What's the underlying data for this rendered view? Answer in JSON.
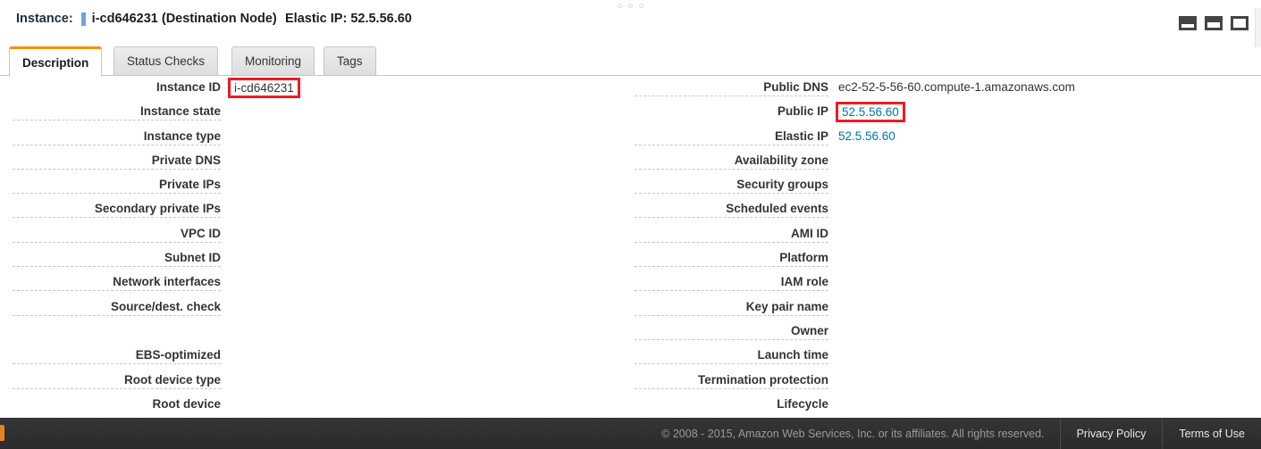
{
  "window": {
    "grip_dots": 3,
    "layout_icons": [
      {
        "name": "panel-size-small",
        "label": "Small panel"
      },
      {
        "name": "panel-size-medium",
        "label": "Medium panel"
      },
      {
        "name": "panel-size-large",
        "label": "Large panel"
      }
    ]
  },
  "header": {
    "instance_label": "Instance:",
    "instance_id": "i-cd646231 (Destination Node)",
    "elastic_ip_label": "Elastic IP:",
    "elastic_ip_value": "52.5.56.60",
    "elastic_ip_full": "Elastic IP: 52.5.56.60"
  },
  "tabs": [
    {
      "label": "Description",
      "active": true
    },
    {
      "label": "Status Checks",
      "active": false
    },
    {
      "label": "Monitoring",
      "active": false
    },
    {
      "label": "Tags",
      "active": false
    }
  ],
  "details": {
    "left": [
      {
        "label": "Instance ID",
        "value": "i-cd646231",
        "highlight": true,
        "dotted": false
      },
      {
        "label": "Instance state",
        "value": "",
        "highlight": false,
        "dotted": true
      },
      {
        "label": "Instance type",
        "value": "",
        "highlight": false,
        "dotted": true
      },
      {
        "label": "Private DNS",
        "value": "",
        "highlight": false,
        "dotted": true
      },
      {
        "label": "Private IPs",
        "value": "",
        "highlight": false,
        "dotted": true
      },
      {
        "label": "Secondary private IPs",
        "value": "",
        "highlight": false,
        "dotted": true
      },
      {
        "label": "VPC ID",
        "value": "",
        "highlight": false,
        "dotted": true
      },
      {
        "label": "Subnet ID",
        "value": "",
        "highlight": false,
        "dotted": true
      },
      {
        "label": "Network interfaces",
        "value": "",
        "highlight": false,
        "dotted": true
      },
      {
        "label": "Source/dest. check",
        "value": "",
        "highlight": false,
        "dotted": true
      },
      {
        "label": "",
        "value": "",
        "highlight": false,
        "dotted": false
      },
      {
        "label": "EBS-optimized",
        "value": "",
        "highlight": false,
        "dotted": true
      },
      {
        "label": "Root device type",
        "value": "",
        "highlight": false,
        "dotted": true
      },
      {
        "label": "Root device",
        "value": "",
        "highlight": false,
        "dotted": false
      }
    ],
    "right": [
      {
        "label": "Public DNS",
        "value": "ec2-52-5-56-60.compute-1.amazonaws.com",
        "link": false,
        "highlight": false,
        "dotted": true
      },
      {
        "label": "Public IP",
        "value": "52.5.56.60",
        "link": true,
        "highlight": true,
        "dotted": false
      },
      {
        "label": "Elastic IP",
        "value": "52.5.56.60",
        "link": true,
        "highlight": false,
        "dotted": true
      },
      {
        "label": "Availability zone",
        "value": "",
        "link": false,
        "highlight": false,
        "dotted": true
      },
      {
        "label": "Security groups",
        "value": "",
        "link": false,
        "highlight": false,
        "dotted": true
      },
      {
        "label": "Scheduled events",
        "value": "",
        "link": false,
        "highlight": false,
        "dotted": true
      },
      {
        "label": "AMI ID",
        "value": "",
        "link": false,
        "highlight": false,
        "dotted": true
      },
      {
        "label": "Platform",
        "value": "",
        "link": false,
        "highlight": false,
        "dotted": true
      },
      {
        "label": "IAM role",
        "value": "",
        "link": false,
        "highlight": false,
        "dotted": true
      },
      {
        "label": "Key pair name",
        "value": "",
        "link": false,
        "highlight": false,
        "dotted": true
      },
      {
        "label": "Owner",
        "value": "",
        "link": false,
        "highlight": false,
        "dotted": true
      },
      {
        "label": "Launch time",
        "value": "",
        "link": false,
        "highlight": false,
        "dotted": true
      },
      {
        "label": "Termination protection",
        "value": "",
        "link": false,
        "highlight": false,
        "dotted": true
      },
      {
        "label": "Lifecycle",
        "value": "",
        "link": false,
        "highlight": false,
        "dotted": false
      }
    ]
  },
  "footer": {
    "copyright": "© 2008 - 2015, Amazon Web Services, Inc. or its affiliates. All rights reserved.",
    "links": [
      {
        "label": "Privacy Policy"
      },
      {
        "label": "Terms of Use"
      }
    ]
  },
  "colors": {
    "accent_orange": "#f0920b",
    "link_blue": "#0073bb",
    "annotation_red": "#ee1c24",
    "name_bar_blue": "#6ba4dd",
    "footer_dark": "#2b2b2b"
  }
}
